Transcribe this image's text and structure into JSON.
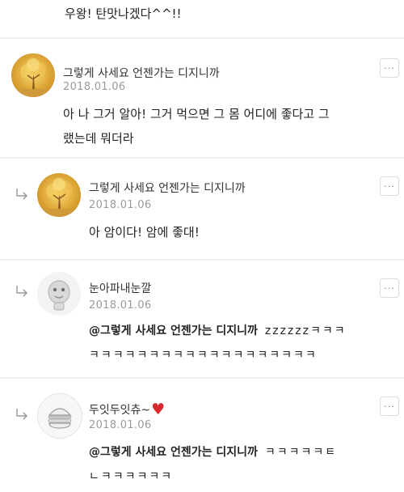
{
  "top": {
    "text": "우왕! 탄맛나겠다^^!!"
  },
  "comments": [
    {
      "author": "그렇게 사세요 언젠가는 디지니까",
      "date": "2018.01.06",
      "line1": "아 나 그거 알아! 그거 먹으면 그 몸 어디에 좋다고 그",
      "line2": "랬는데 뭐더라",
      "more": "···"
    },
    {
      "author": "그렇게 사세요 언젠가는 디지니까",
      "date": "2018.01.06",
      "line1": "아 암이다! 암에 좋대!",
      "more": "···"
    },
    {
      "author": "눈아파내눈깔",
      "date": "2018.01.06",
      "mention": "@그렇게 사세요 언젠가는 디지니까",
      "tail": "zzzzzzㅋㅋㅋ",
      "line2": "ㅋㅋㅋㅋㅋㅋㅋㅋㅋㅋㅋㅋㅋㅋㅋㅋㅋㅋㅋ",
      "more": "···"
    },
    {
      "author": "두잇두잇츄~",
      "author_emoji": "♥",
      "date": "2018.01.06",
      "mention": "@그렇게 사세요 언젠가는 디지니까",
      "tail": "ㅋㅋㅋㅋㅋㅌ",
      "line2": "ㄴㅋㅋㅋㅋㅋㅋ",
      "more": "···"
    }
  ],
  "colors": {
    "separator": "#ededed",
    "date": "#9a9a9a",
    "heart": "#d9272e"
  }
}
